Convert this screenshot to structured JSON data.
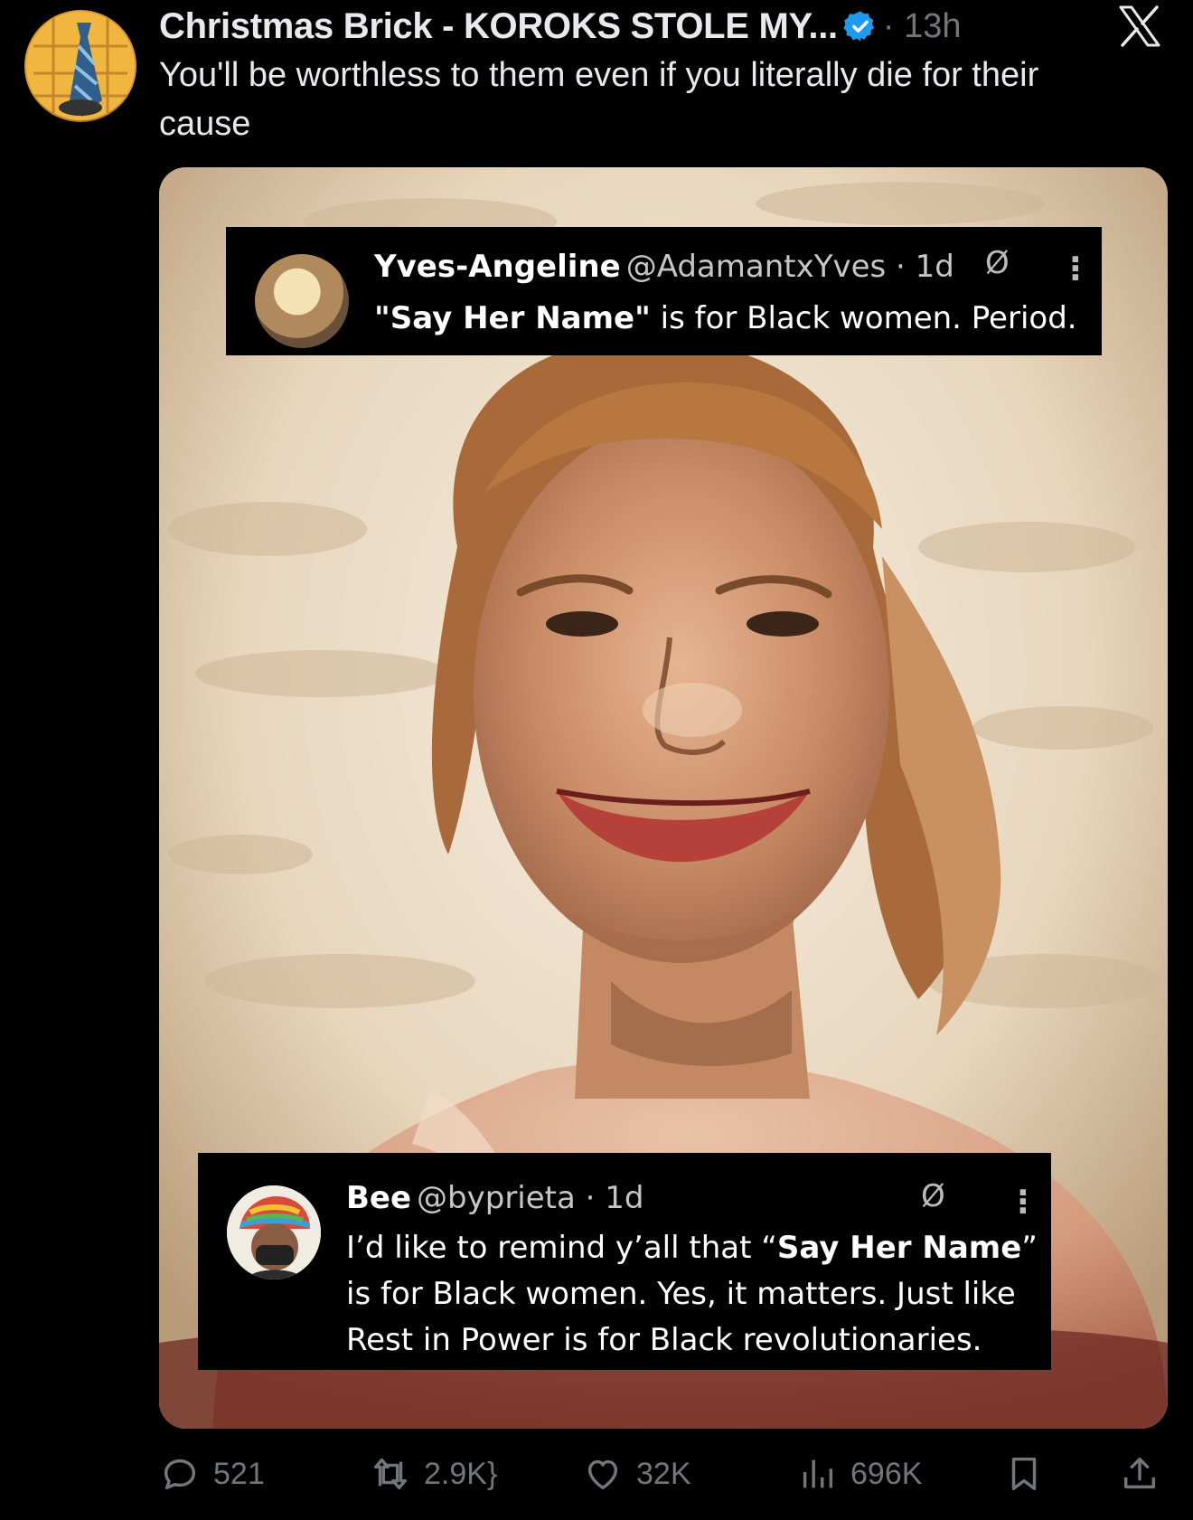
{
  "author": {
    "display_name": "Christmas Brick - KOROKS STOLE MY...",
    "verified": true,
    "time": "· 13h"
  },
  "tweet": {
    "text": "You'll be worthless to them even if you literally die for their cause"
  },
  "media": {
    "captions": [
      {
        "name": "Yves-Angeline",
        "handle": "@AdamantxYves · 1d",
        "body_parts": [
          "\"Say Her Name\"",
          " is for Black women. Period."
        ]
      },
      {
        "name": "Bee",
        "handle": "@byprieta · 1d",
        "body_parts": [
          "I’d like to remind y’all that “",
          "Say Her Name",
          "” is for Black women. Yes, it matters. Just like Rest in Power is for Black revolutionaries."
        ]
      }
    ]
  },
  "actions": {
    "replies": "521",
    "reposts": "2.9K",
    "likes": "32K",
    "views": "696K"
  },
  "colors": {
    "background": "#000000",
    "text": "#e7e9ea",
    "muted": "#71767b",
    "verified": "#1d9bf0"
  }
}
